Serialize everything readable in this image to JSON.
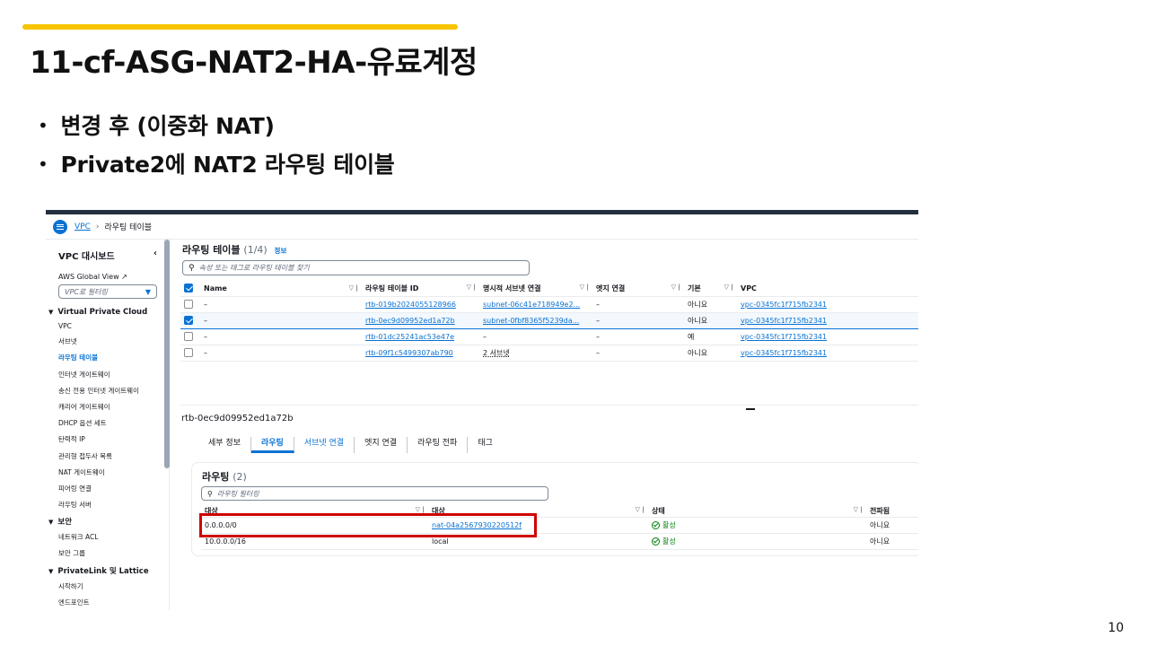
{
  "slide": {
    "title": "11-cf-ASG-NAT2-HA-유료계정",
    "bullets": [
      "변경 후 (이중화 NAT)",
      "Private2에 NAT2 라우팅 테이블"
    ],
    "page_number": "10",
    "accent_color": "#f7c500",
    "highlight_color": "#d00000"
  },
  "console": {
    "breadcrumb": {
      "service": "VPC",
      "current": "라우팅 테이블"
    },
    "sidebar": {
      "title": "VPC 대시보드",
      "global_view": "AWS Global View",
      "filter_placeholder": "VPC로 필터링",
      "sections": [
        {
          "label": "Virtual Private Cloud",
          "items": [
            "VPC",
            "서브넷",
            "라우팅 테이블",
            "인터넷 게이트웨이",
            "송신 전용 인터넷 게이트웨이",
            "캐리어 게이트웨이",
            "DHCP 옵션 세트",
            "탄력적 IP",
            "관리형 접두사 목록",
            "NAT 게이트웨이",
            "피어링 연결",
            "라우팅 서버"
          ]
        },
        {
          "label": "보안",
          "items": [
            "네트워크 ACL",
            "보안 그룹"
          ]
        },
        {
          "label": "PrivateLink 및 Lattice",
          "items": [
            "시작하기",
            "엔드포인트"
          ]
        }
      ],
      "active_item": "라우팅 테이블"
    },
    "route_tables": {
      "title": "라우팅 테이블",
      "count": "(1/4)",
      "info": "정보",
      "search_placeholder": "속성 또는 태그로 라우팅 테이블 찾기",
      "columns": [
        "Name",
        "라우팅 테이블 ID",
        "명시적 서브넷 연결",
        "엣지 연결",
        "기본",
        "VPC"
      ],
      "rows": [
        {
          "name": "–",
          "id": "rtb-019b2024055128966",
          "subnet": "subnet-06c41e718949e2...",
          "edge": "–",
          "main": "아니요",
          "vpc": "vpc-0345fc1f715fb2341",
          "selected": false
        },
        {
          "name": "–",
          "id": "rtb-0ec9d09952ed1a72b",
          "subnet": "subnet-0fbf8365f5239da...",
          "edge": "–",
          "main": "아니요",
          "vpc": "vpc-0345fc1f715fb2341",
          "selected": true
        },
        {
          "name": "–",
          "id": "rtb-01dc25241ac53e47e",
          "subnet": "–",
          "edge": "–",
          "main": "예",
          "vpc": "vpc-0345fc1f715fb2341",
          "selected": false
        },
        {
          "name": "–",
          "id": "rtb-09f1c5499307ab790",
          "subnet": "2 서브넷",
          "edge": "–",
          "main": "아니요",
          "vpc": "vpc-0345fc1f715fb2341",
          "selected": false
        }
      ]
    },
    "detail": {
      "selected_id": "rtb-0ec9d09952ed1a72b",
      "tabs": [
        "세부 정보",
        "라우팅",
        "서브넷 연결",
        "엣지 연결",
        "라우팅 전파",
        "태그"
      ],
      "active_tab": "라우팅",
      "routes": {
        "title": "라우팅",
        "count": "(2)",
        "search_placeholder": "라우팅 필터링",
        "columns": [
          "대상",
          "대상",
          "상태",
          "전파됨"
        ],
        "rows": [
          {
            "destination": "0.0.0.0/0",
            "target": "nat-04a2567930220512f",
            "status": "활성",
            "propagated": "아니요"
          },
          {
            "destination": "10.0.0.0/16",
            "target": "local",
            "status": "활성",
            "propagated": "아니요"
          }
        ]
      }
    }
  }
}
